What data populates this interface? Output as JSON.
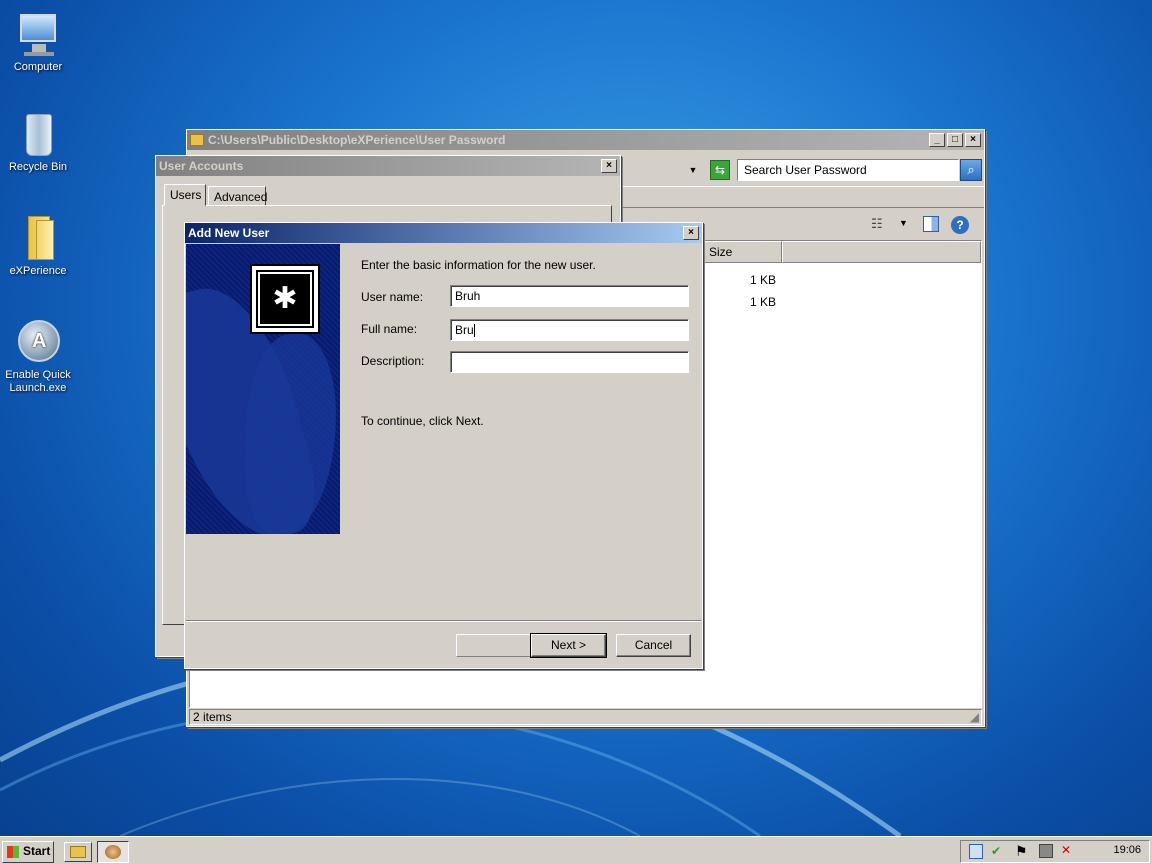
{
  "desktop": {
    "icons": [
      {
        "label": "Computer",
        "icon": "computer-icon"
      },
      {
        "label": "Recycle Bin",
        "icon": "recycle-bin-icon"
      },
      {
        "label": "eXPerience",
        "icon": "folder-icon"
      },
      {
        "label_line1": "Enable Quick",
        "label_line2": "Launch.exe",
        "icon": "app-icon"
      }
    ]
  },
  "explorer": {
    "title": "C:\\Users\\Public\\Desktop\\eXPerience\\User Password",
    "search_placeholder": "Search User Password",
    "column_size": "Size",
    "rows": [
      {
        "size": "1 KB"
      },
      {
        "size": "1 KB"
      }
    ],
    "status": "2 items"
  },
  "user_accounts": {
    "title": "User Accounts",
    "tabs": [
      "Users",
      "Advanced"
    ]
  },
  "wizard": {
    "title": "Add New User",
    "intro": "Enter the basic information for the new user.",
    "fields": {
      "user_name_label": "User name:",
      "user_name_value": "Bruh",
      "full_name_label": "Full name:",
      "full_name_value": "Bru",
      "description_label": "Description:",
      "description_value": ""
    },
    "continue_text": "To continue, click Next.",
    "next_label": "Next >",
    "cancel_label": "Cancel"
  },
  "taskbar": {
    "start_label": "Start",
    "clock": "19:06"
  },
  "colors": {
    "desktop_blue": "#1a75cf",
    "active_title": "#0a246a",
    "window_face": "#d4d0c8"
  }
}
